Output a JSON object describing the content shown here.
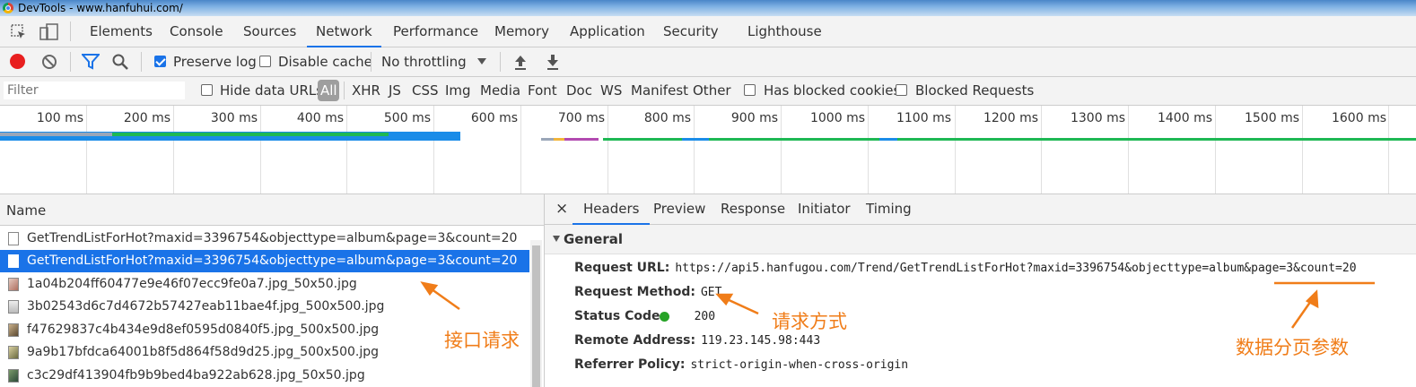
{
  "window": {
    "title": "DevTools - www.hanfuhui.com/"
  },
  "tabs": [
    "Elements",
    "Console",
    "Sources",
    "Network",
    "Performance",
    "Memory",
    "Application",
    "Security",
    "Lighthouse"
  ],
  "active_tab": "Network",
  "toolbar": {
    "preserve_log": "Preserve log",
    "disable_cache": "Disable cache",
    "throttling": "No throttling"
  },
  "filterbar": {
    "filter_placeholder": "Filter",
    "hide_data_urls": "Hide data URLs",
    "types": [
      "All",
      "XHR",
      "JS",
      "CSS",
      "Img",
      "Media",
      "Font",
      "Doc",
      "WS",
      "Manifest",
      "Other"
    ],
    "has_blocked_cookies": "Has blocked cookies",
    "blocked_requests": "Blocked Requests"
  },
  "overview": {
    "ticks": [
      "100 ms",
      "200 ms",
      "300 ms",
      "400 ms",
      "500 ms",
      "600 ms",
      "700 ms",
      "800 ms",
      "900 ms",
      "1000 ms",
      "1100 ms",
      "1200 ms",
      "1300 ms",
      "1400 ms",
      "1500 ms",
      "1600 ms"
    ]
  },
  "requests": {
    "header": "Name",
    "rows": [
      {
        "name": "GetTrendListForHot?maxid=3396754&objecttype=album&page=3&count=20",
        "icon": "document-icon"
      },
      {
        "name": "GetTrendListForHot?maxid=3396754&objecttype=album&page=3&count=20",
        "icon": "document-icon"
      },
      {
        "name": "1a04b204ff60477e9e46f07ecc9fe0a7.jpg_50x50.jpg",
        "icon": "image-icon"
      },
      {
        "name": "3b02543d6c7d4672b57427eab11bae4f.jpg_500x500.jpg",
        "icon": "image-icon"
      },
      {
        "name": "f47629837c4b434e9d8ef0595d0840f5.jpg_500x500.jpg",
        "icon": "image-icon"
      },
      {
        "name": "9a9b17bfdca64001b8f5d864f58d9d25.jpg_500x500.jpg",
        "icon": "image-icon"
      },
      {
        "name": "c3c29df413904fb9b9bed4ba922ab628.jpg_50x50.jpg",
        "icon": "image-icon"
      }
    ]
  },
  "detail": {
    "close": "×",
    "tabs": [
      "Headers",
      "Preview",
      "Response",
      "Initiator",
      "Timing"
    ],
    "section": "General",
    "fields": {
      "request_url_label": "Request URL:",
      "request_url": "https://api5.hanfugou.com/Trend/GetTrendListForHot?maxid=3396754&objecttype=album&page=3&count=20",
      "method_label": "Request Method:",
      "method": "GET",
      "status_label": "Status Code:",
      "status": "200",
      "remote_label": "Remote Address:",
      "remote": "119.23.145.98:443",
      "referrer_label": "Referrer Policy:",
      "referrer": "strict-origin-when-cross-origin"
    }
  },
  "annotations": {
    "api": "接口请求",
    "method": "请求方式",
    "paging": "数据分页参数"
  },
  "colors": {
    "accent": "#1a73e8",
    "annotation": "#f07d19",
    "record": "#e81f1f",
    "status_ok": "#27a327"
  }
}
